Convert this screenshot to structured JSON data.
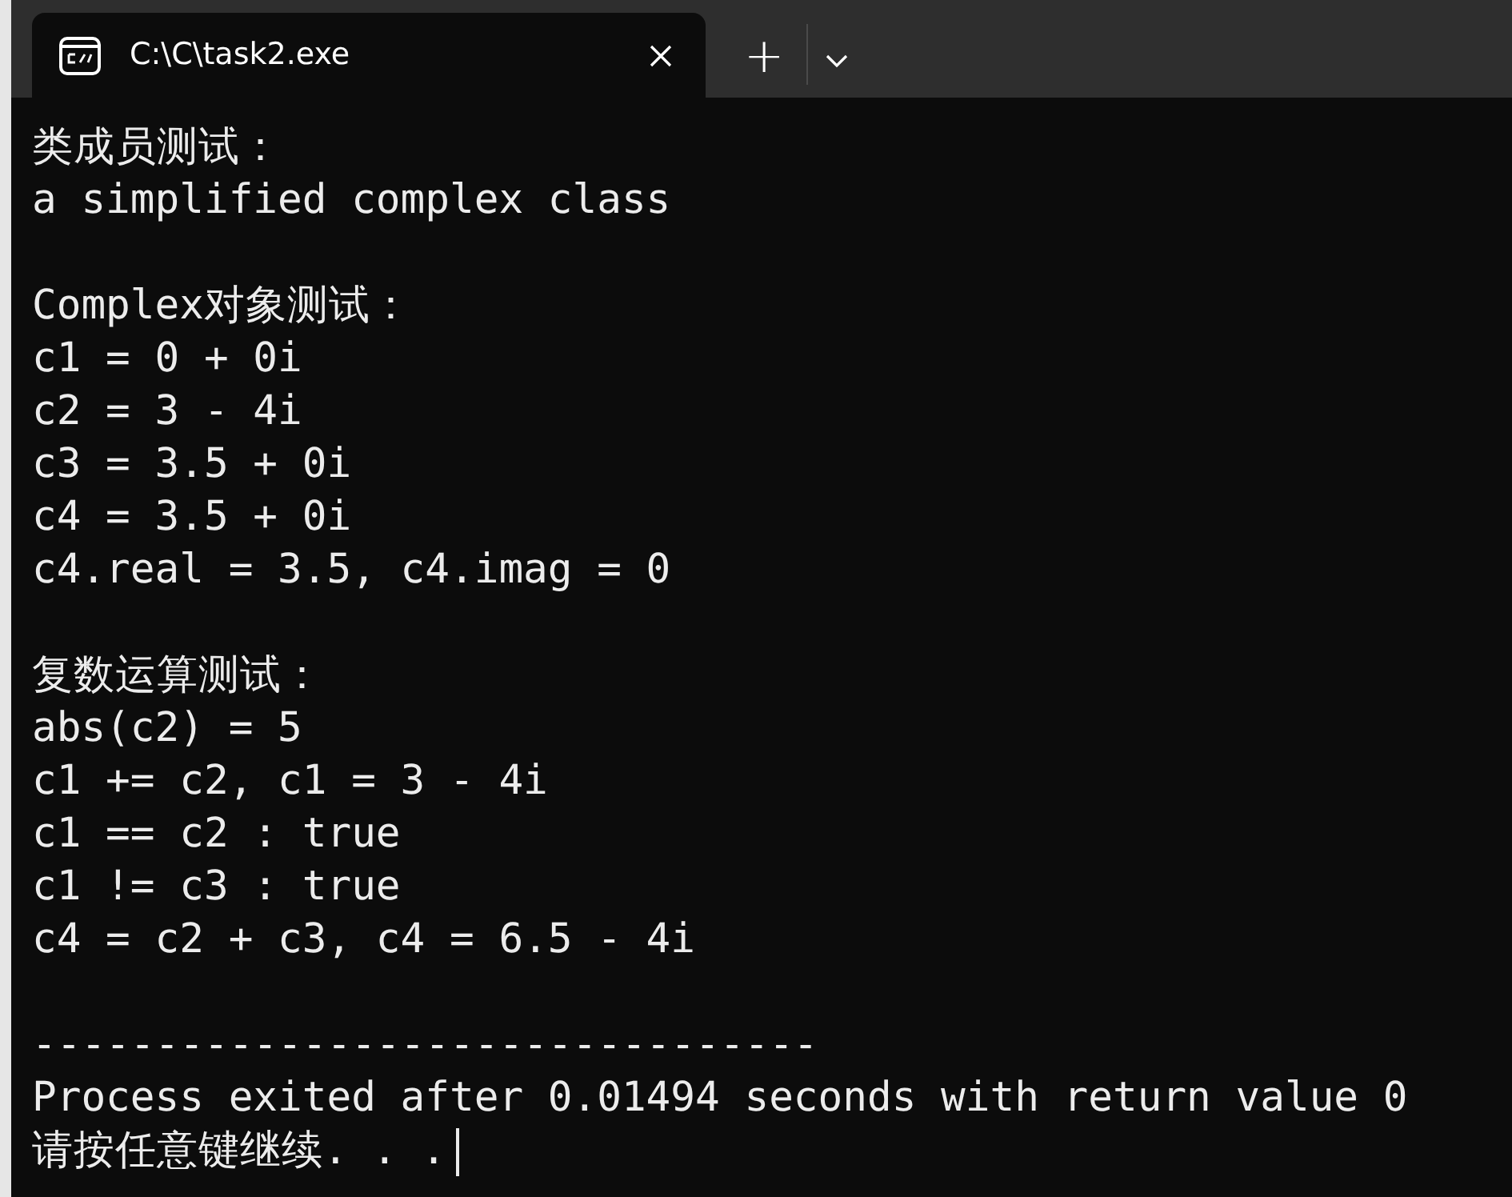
{
  "tab": {
    "title": "C:\\C\\task2.exe",
    "selected": true
  },
  "tab_bar": {
    "new_tab": "+"
  },
  "console": {
    "blocks": [
      [
        "类成员测试：",
        "a simplified complex class"
      ],
      [
        "Complex对象测试：",
        "c1 = 0 + 0i",
        "c2 = 3 - 4i",
        "c3 = 3.5 + 0i",
        "c4 = 3.5 + 0i",
        "c4.real = 3.5, c4.imag = 0"
      ],
      [
        "复数运算测试：",
        "abs(c2) = 5",
        "c1 += c2, c1 = 3 - 4i",
        "c1 == c2 : true",
        "c1 != c3 : true",
        "c4 = c2 + c3, c4 = 6.5 - 4i"
      ],
      [
        "--------------------------------",
        "Process exited after 0.01494 seconds with return value 0",
        "请按任意键继续. . ."
      ]
    ]
  }
}
